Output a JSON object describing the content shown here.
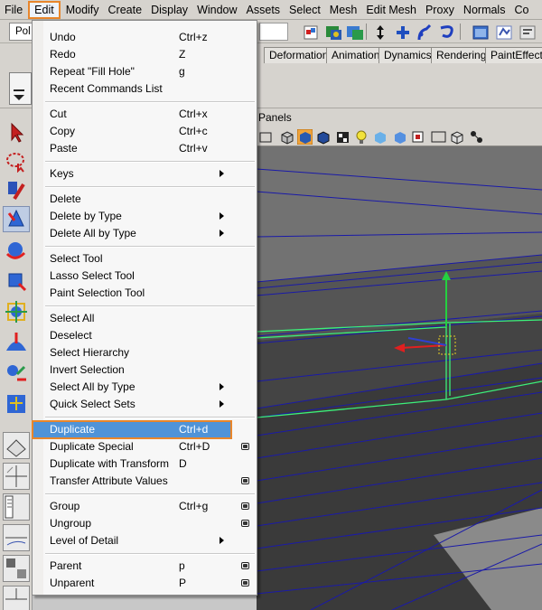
{
  "menubar": {
    "items": [
      "File",
      "Edit",
      "Modify",
      "Create",
      "Display",
      "Window",
      "Assets",
      "Select",
      "Mesh",
      "Edit Mesh",
      "Proxy",
      "Normals",
      "Co"
    ],
    "active_index": 1
  },
  "statusline": {
    "mode_value": "Pol"
  },
  "shelf": {
    "tabs": [
      "Deformation",
      "Animation",
      "Dynamics",
      "Rendering",
      "PaintEffects"
    ]
  },
  "panel": {
    "menu_label": "Panels"
  },
  "edit_menu": {
    "items": [
      {
        "label": "Undo",
        "shortcut": "Ctrl+z",
        "submenu": false,
        "option_box": false,
        "name": "undo"
      },
      {
        "label": "Redo",
        "shortcut": "Z",
        "submenu": false,
        "option_box": false,
        "name": "redo"
      },
      {
        "label": "Repeat \"Fill Hole\"",
        "shortcut": "g",
        "submenu": false,
        "option_box": false,
        "name": "repeat-last"
      },
      {
        "label": "Recent Commands List",
        "shortcut": "",
        "submenu": false,
        "option_box": false,
        "name": "recent-commands-list"
      },
      {
        "label": "Cut",
        "shortcut": "Ctrl+x",
        "submenu": false,
        "option_box": false,
        "name": "cut"
      },
      {
        "label": "Copy",
        "shortcut": "Ctrl+c",
        "submenu": false,
        "option_box": false,
        "name": "copy"
      },
      {
        "label": "Paste",
        "shortcut": "Ctrl+v",
        "submenu": false,
        "option_box": false,
        "name": "paste"
      },
      {
        "label": "Keys",
        "shortcut": "",
        "submenu": true,
        "option_box": false,
        "name": "keys"
      },
      {
        "label": "Delete",
        "shortcut": "",
        "submenu": false,
        "option_box": false,
        "name": "delete"
      },
      {
        "label": "Delete by Type",
        "shortcut": "",
        "submenu": true,
        "option_box": false,
        "name": "delete-by-type"
      },
      {
        "label": "Delete All by Type",
        "shortcut": "",
        "submenu": true,
        "option_box": false,
        "name": "delete-all-by-type"
      },
      {
        "label": "Select Tool",
        "shortcut": "",
        "submenu": false,
        "option_box": false,
        "name": "select-tool"
      },
      {
        "label": "Lasso Select Tool",
        "shortcut": "",
        "submenu": false,
        "option_box": false,
        "name": "lasso-select-tool"
      },
      {
        "label": "Paint Selection Tool",
        "shortcut": "",
        "submenu": false,
        "option_box": false,
        "name": "paint-selection-tool"
      },
      {
        "label": "Select All",
        "shortcut": "",
        "submenu": false,
        "option_box": false,
        "name": "select-all"
      },
      {
        "label": "Deselect",
        "shortcut": "",
        "submenu": false,
        "option_box": false,
        "name": "deselect"
      },
      {
        "label": "Select Hierarchy",
        "shortcut": "",
        "submenu": false,
        "option_box": false,
        "name": "select-hierarchy"
      },
      {
        "label": "Invert Selection",
        "shortcut": "",
        "submenu": false,
        "option_box": false,
        "name": "invert-selection"
      },
      {
        "label": "Select All by Type",
        "shortcut": "",
        "submenu": true,
        "option_box": false,
        "name": "select-all-by-type"
      },
      {
        "label": "Quick Select Sets",
        "shortcut": "",
        "submenu": true,
        "option_box": false,
        "name": "quick-select-sets"
      },
      {
        "label": "Duplicate",
        "shortcut": "Ctrl+d",
        "submenu": false,
        "option_box": false,
        "name": "duplicate",
        "highlighted": true
      },
      {
        "label": "Duplicate Special",
        "shortcut": "Ctrl+D",
        "submenu": false,
        "option_box": true,
        "name": "duplicate-special"
      },
      {
        "label": "Duplicate with Transform",
        "shortcut": "D",
        "submenu": false,
        "option_box": false,
        "name": "duplicate-with-transform"
      },
      {
        "label": "Transfer Attribute Values",
        "shortcut": "",
        "submenu": false,
        "option_box": true,
        "name": "transfer-attribute-values"
      },
      {
        "label": "Group",
        "shortcut": "Ctrl+g",
        "submenu": false,
        "option_box": true,
        "name": "group"
      },
      {
        "label": "Ungroup",
        "shortcut": "",
        "submenu": false,
        "option_box": true,
        "name": "ungroup"
      },
      {
        "label": "Level of Detail",
        "shortcut": "",
        "submenu": true,
        "option_box": false,
        "name": "level-of-detail"
      },
      {
        "label": "Parent",
        "shortcut": "p",
        "submenu": false,
        "option_box": true,
        "name": "parent"
      },
      {
        "label": "Unparent",
        "shortcut": "P",
        "submenu": false,
        "option_box": true,
        "name": "unparent"
      }
    ]
  },
  "colors": {
    "highlight_fill": "#4f93d8",
    "highlight_outline": "#e8862b",
    "selection_wire": "#3cf07a",
    "wireframe": "#1a1aa8"
  }
}
